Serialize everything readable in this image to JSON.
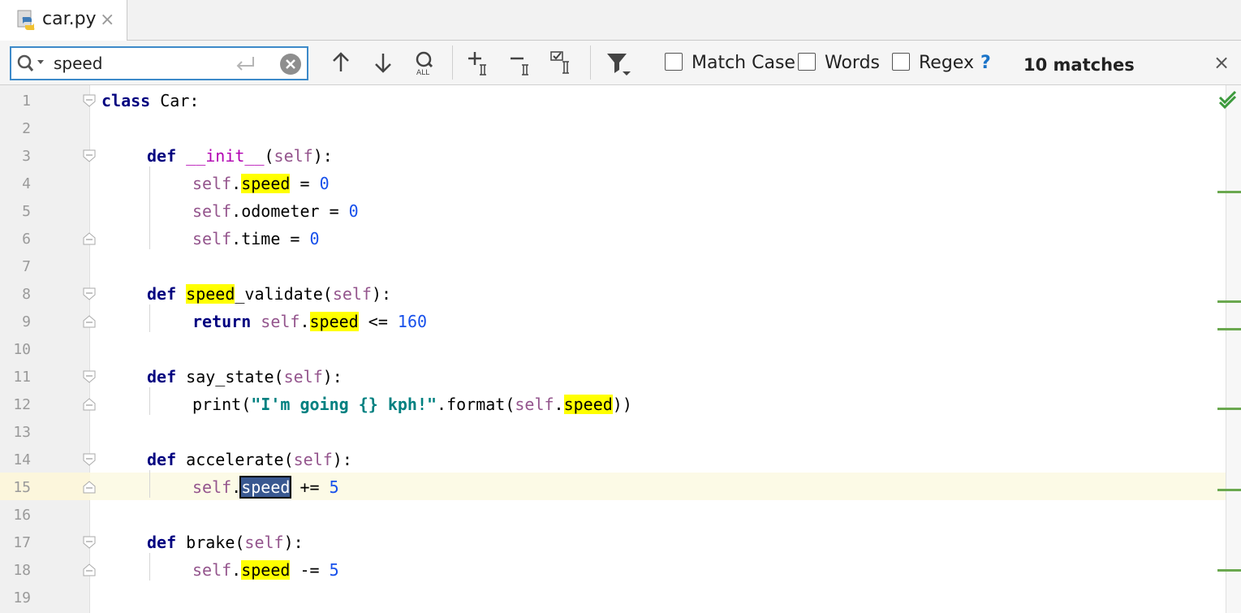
{
  "tab": {
    "label": "car.py",
    "close": "×"
  },
  "search": {
    "query": "speed",
    "clear": "×"
  },
  "options": {
    "match_case": {
      "label": "Match Case",
      "checked": false
    },
    "words": {
      "label": "Words",
      "checked": false
    },
    "regex": {
      "label": "Regex",
      "checked": false
    },
    "help": "?"
  },
  "status": {
    "matches": "10 matches"
  },
  "close_search": "×",
  "line_numbers": [
    "1",
    "2",
    "3",
    "4",
    "5",
    "6",
    "7",
    "8",
    "9",
    "10",
    "11",
    "12",
    "13",
    "14",
    "15",
    "16",
    "17",
    "18",
    "19"
  ],
  "code": {
    "l1": {
      "kw": "class",
      "rest": " Car:"
    },
    "l3": {
      "kw": "def",
      "sp": " ",
      "fn": "__init__",
      "p1": "(",
      "self": "self",
      "p2": "):"
    },
    "l4": {
      "self": "self",
      "dot": ".",
      "hl": "speed",
      "op": " = ",
      "num": "0"
    },
    "l5": {
      "self": "self",
      "rest": ".odometer = ",
      "num": "0"
    },
    "l6": {
      "self": "self",
      "rest": ".time = ",
      "num": "0"
    },
    "l8": {
      "kw": "def",
      "sp": " ",
      "hl": "speed",
      "rest": "_validate(",
      "self": "self",
      "p2": "):"
    },
    "l9": {
      "kw": "return",
      "sp": " ",
      "self": "self",
      "dot": ".",
      "hl": "speed",
      "op": " <= ",
      "num": "160"
    },
    "l11": {
      "kw": "def",
      "rest": " say_state(",
      "self": "self",
      "p2": "):"
    },
    "l12": {
      "fn": "print(",
      "str": "\"I'm going {} kph!\"",
      "rest": ".format(",
      "self": "self",
      "dot": ".",
      "hl": "speed",
      "end": "))"
    },
    "l14": {
      "kw": "def",
      "rest": " accelerate(",
      "self": "self",
      "p2": "):"
    },
    "l15": {
      "self": "self",
      "dot": ".",
      "sel": "speed",
      "op": " += ",
      "num": "5"
    },
    "l17": {
      "kw": "def",
      "rest": " brake(",
      "self": "self",
      "p2": "):"
    },
    "l18": {
      "self": "self",
      "dot": ".",
      "hl": "speed",
      "op": " -= ",
      "num": "5"
    }
  },
  "colors": {
    "accent": "#3d8ac9",
    "highlight": "#ffff00",
    "selection": "#395890",
    "marker": "#6aa84f"
  }
}
